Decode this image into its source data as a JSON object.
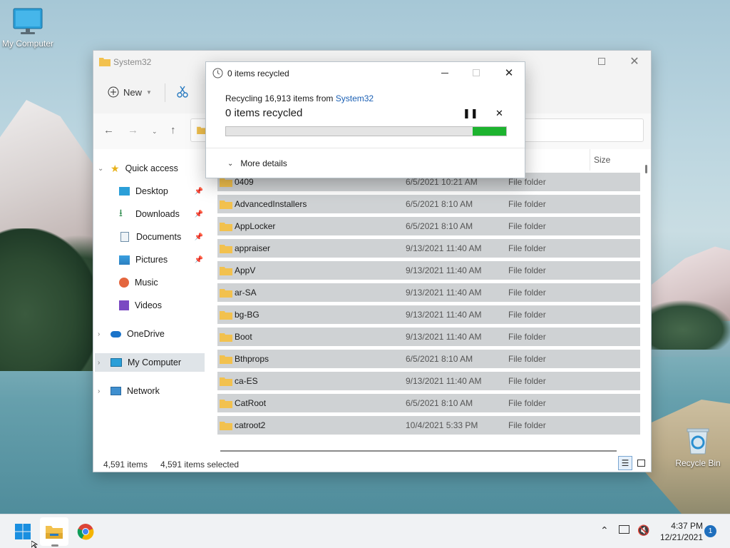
{
  "desktop": {
    "icons": [
      {
        "label": "My Computer",
        "icon": "monitor-icon"
      },
      {
        "label": "Recycle Bin",
        "icon": "recycle-bin-icon"
      }
    ]
  },
  "explorer": {
    "title": "System32",
    "toolbar": {
      "new_label": "New",
      "new_icon": "plus-circle-icon",
      "cut_icon": "scissors-icon"
    },
    "nav": [
      {
        "label": "Quick access",
        "icon": "star-icon",
        "expanded": true
      },
      {
        "label": "Desktop",
        "icon": "desktop-folder-icon",
        "pinned": true
      },
      {
        "label": "Downloads",
        "icon": "download-icon",
        "pinned": true
      },
      {
        "label": "Documents",
        "icon": "documents-icon",
        "pinned": true
      },
      {
        "label": "Pictures",
        "icon": "pictures-icon",
        "pinned": true
      },
      {
        "label": "Music",
        "icon": "music-icon"
      },
      {
        "label": "Videos",
        "icon": "videos-icon"
      },
      {
        "label": "OneDrive",
        "icon": "cloud-icon"
      },
      {
        "label": "My Computer",
        "icon": "monitor-icon",
        "selected": true
      },
      {
        "label": "Network",
        "icon": "network-icon"
      }
    ],
    "columns": {
      "size": "Size"
    },
    "rows": [
      {
        "name": "0409",
        "date": "6/5/2021 10:21 AM",
        "type": "File folder"
      },
      {
        "name": "AdvancedInstallers",
        "date": "6/5/2021 8:10 AM",
        "type": "File folder"
      },
      {
        "name": "AppLocker",
        "date": "6/5/2021 8:10 AM",
        "type": "File folder"
      },
      {
        "name": "appraiser",
        "date": "9/13/2021 11:40 AM",
        "type": "File folder"
      },
      {
        "name": "AppV",
        "date": "9/13/2021 11:40 AM",
        "type": "File folder"
      },
      {
        "name": "ar-SA",
        "date": "9/13/2021 11:40 AM",
        "type": "File folder"
      },
      {
        "name": "bg-BG",
        "date": "9/13/2021 11:40 AM",
        "type": "File folder"
      },
      {
        "name": "Boot",
        "date": "9/13/2021 11:40 AM",
        "type": "File folder"
      },
      {
        "name": "Bthprops",
        "date": "6/5/2021 8:10 AM",
        "type": "File folder"
      },
      {
        "name": "ca-ES",
        "date": "9/13/2021 11:40 AM",
        "type": "File folder"
      },
      {
        "name": "CatRoot",
        "date": "6/5/2021 8:10 AM",
        "type": "File folder"
      },
      {
        "name": "catroot2",
        "date": "10/4/2021 5:33 PM",
        "type": "File folder"
      }
    ],
    "status": {
      "count": "4,591 items",
      "selected": "4,591 items selected"
    }
  },
  "dialog": {
    "title": "0 items recycled",
    "subtitle_prefix": "Recycling 16,913 items from ",
    "subtitle_link": "System32",
    "heading": "0 items recycled",
    "progress_fraction": 0.12,
    "more_details": "More details",
    "accent_color": "#1db32f"
  },
  "taskbar": {
    "time": "4:37 PM",
    "date": "12/21/2021",
    "notifications": "1",
    "apps": [
      "windows-start-icon",
      "file-explorer-icon",
      "chrome-icon"
    ]
  }
}
